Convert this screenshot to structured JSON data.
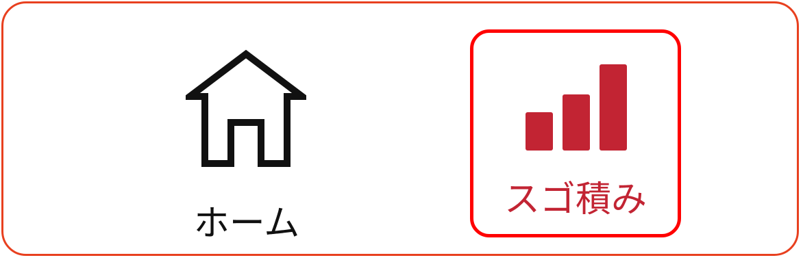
{
  "nav": {
    "items": [
      {
        "label": "ホーム",
        "icon": "home-icon",
        "active": false
      },
      {
        "label": "スゴ積み",
        "icon": "bar-chart-icon",
        "active": true
      }
    ]
  },
  "colors": {
    "outer_border": "#e8401f",
    "highlight_border": "#ff0000",
    "accent": "#c22433",
    "text": "#111111"
  }
}
